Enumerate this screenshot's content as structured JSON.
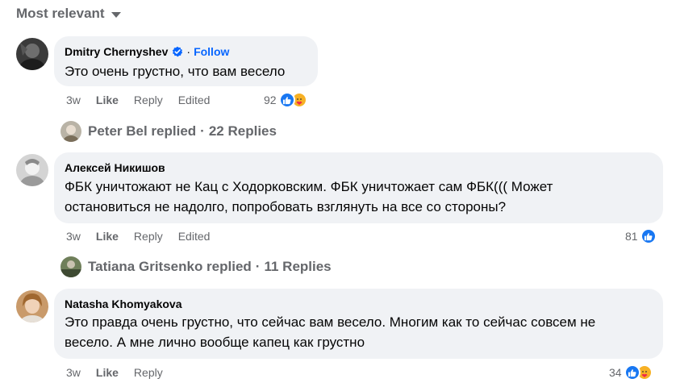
{
  "sort": {
    "label": "Most relevant"
  },
  "comments": [
    {
      "author": "Dmitry Chernyshev",
      "verified": true,
      "follow_label": "Follow",
      "text_lines": [
        "Это очень грустно, что вам весело"
      ],
      "time": "3w",
      "like_label": "Like",
      "reply_label": "Reply",
      "edited_label": "Edited",
      "reaction_count": "92",
      "replies": {
        "author": "Peter Bel replied",
        "sep": "·",
        "count": "22 Replies"
      }
    },
    {
      "author": "Алексей Никишов",
      "text_lines": [
        "ФБК уничтожают не Кац с Ходорковским. ФБК уничтожает сам ФБК((( Может",
        "остановиться не надолго, попробовать взглянуть на все со стороны?"
      ],
      "time": "3w",
      "like_label": "Like",
      "reply_label": "Reply",
      "edited_label": "Edited",
      "reaction_count": "81",
      "replies": {
        "author": "Tatiana Gritsenko replied",
        "sep": "·",
        "count": "11 Replies"
      }
    },
    {
      "author": "Natasha Khomyakova",
      "text_lines": [
        "Это правда очень грустно, что сейчас вам весело. Многим как то сейчас совсем не",
        "весело. А мне лично вообще капец как грустно"
      ],
      "time": "3w",
      "like_label": "Like",
      "reply_label": "Reply",
      "reaction_count": "34"
    }
  ],
  "colors": {
    "link": "#0866ff",
    "muted": "#65676b",
    "bubble": "#f0f2f5",
    "like": "#1877f2",
    "care": "#f7b125"
  },
  "icons": {
    "verified": "verified-badge-icon",
    "like": "like-reaction-icon",
    "care": "care-reaction-icon",
    "sort_caret": "caret-down-icon"
  }
}
